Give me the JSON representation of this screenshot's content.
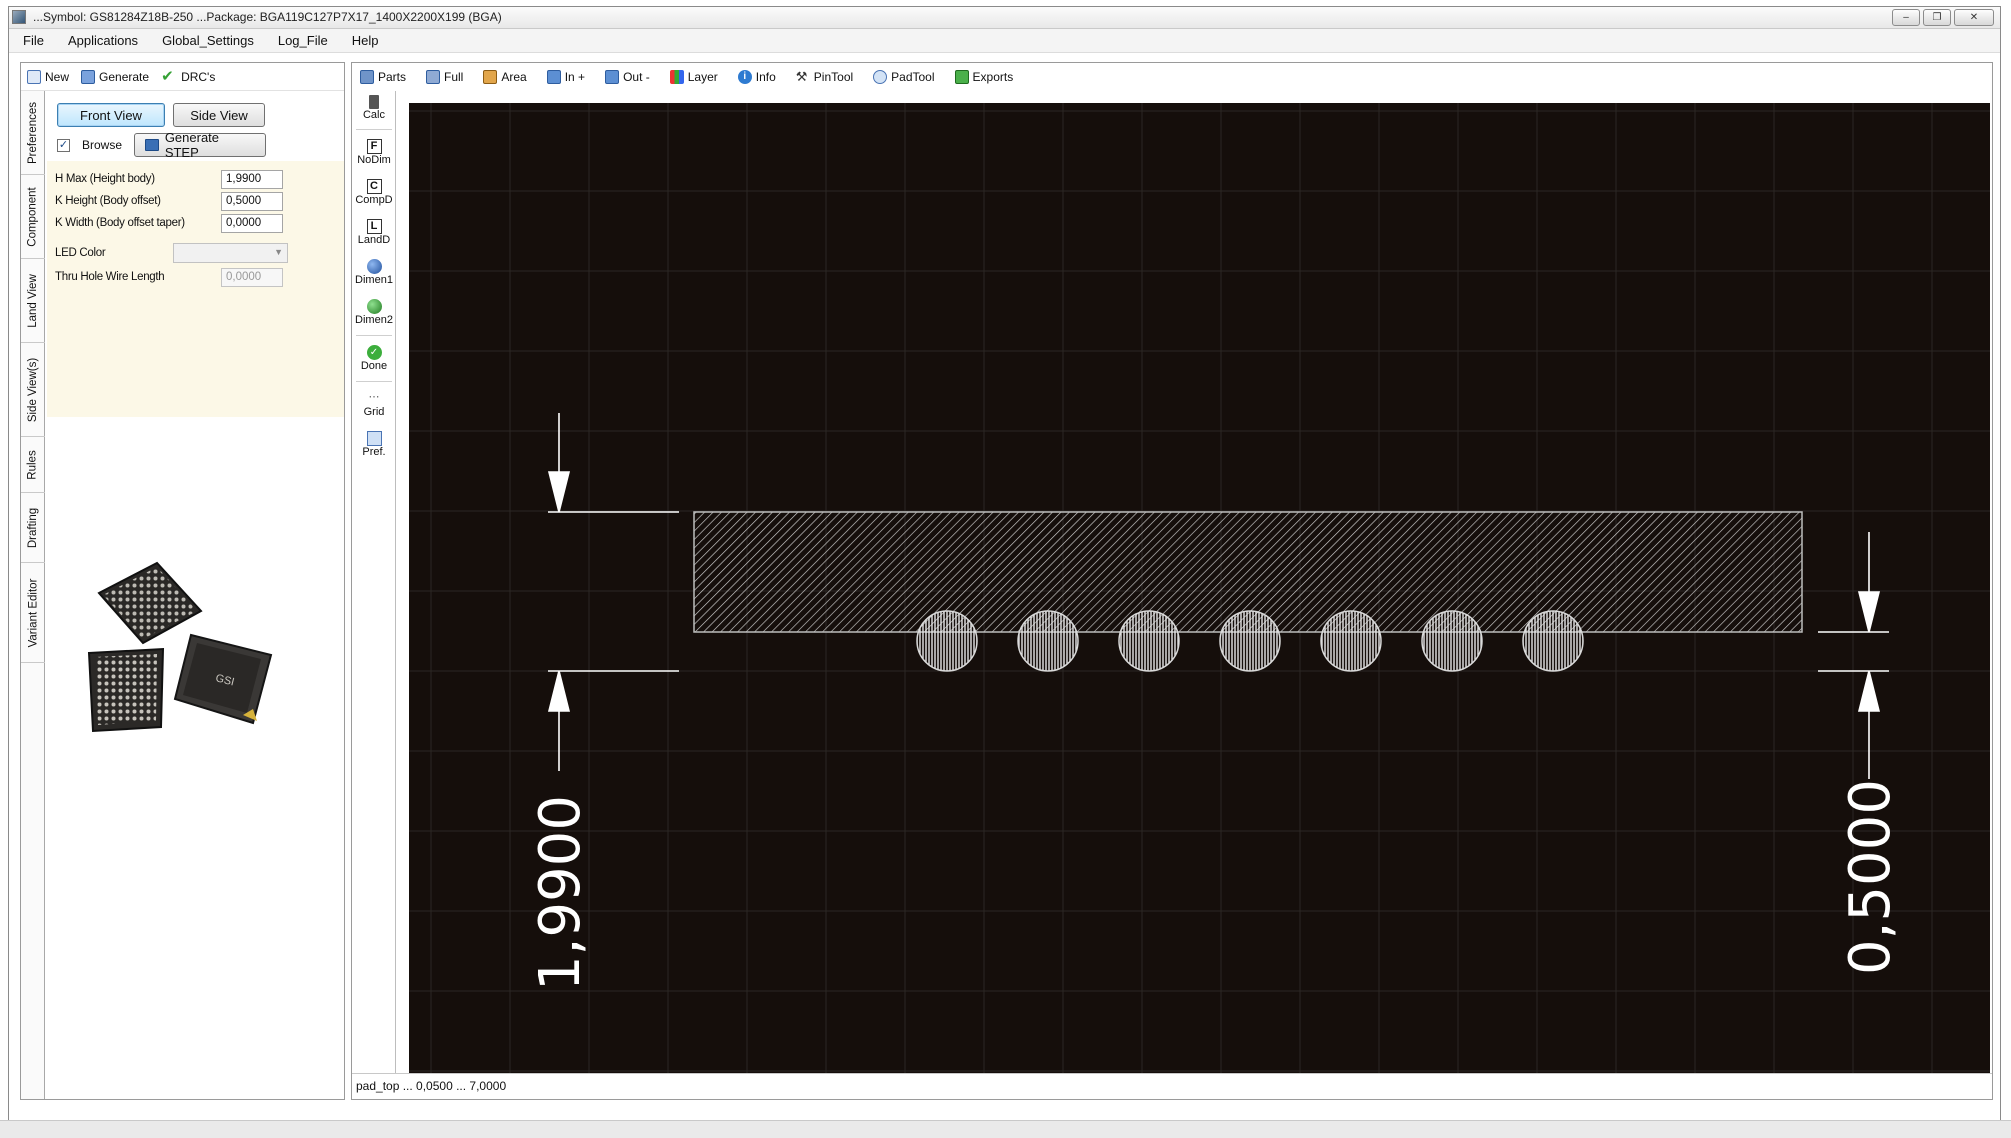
{
  "window": {
    "title": "...Symbol: GS81284Z18B-250 ...Package: BGA119C127P7X17_1400X2200X199  (BGA)",
    "controls": [
      "minimize",
      "maximize",
      "close"
    ]
  },
  "menu": {
    "items": [
      "File",
      "Applications",
      "Global_Settings",
      "Log_File",
      "Help"
    ]
  },
  "left_toolbar": {
    "new_label": "New",
    "generate_label": "Generate",
    "drc_label": "DRC's"
  },
  "vertical_tabs": [
    "Preferences",
    "Component",
    "Land View",
    "Side View(s)",
    "Rules",
    "Drafting",
    "Variant Editor"
  ],
  "view_buttons": {
    "front": "Front View",
    "side": "Side View",
    "browse": "Browse",
    "browse_checked": true,
    "generate_step": "Generate STEP"
  },
  "fields": {
    "h_max": {
      "label": "H Max (Height body)",
      "value": "1,9900"
    },
    "k_height": {
      "label": "K Height (Body offset)",
      "value": "0,5000"
    },
    "k_width": {
      "label": "K Width (Body offset taper)",
      "value": "0,0000"
    },
    "led_color": {
      "label": "LED Color",
      "value": ""
    },
    "thru_hole": {
      "label": "Thru Hole Wire Length",
      "value": "0,0000"
    }
  },
  "chip_image": {
    "logo_text": "GSI"
  },
  "main_toolbar": {
    "items": [
      {
        "label": "Parts",
        "icon": "parts-icon"
      },
      {
        "label": "Full",
        "icon": "full-view-icon"
      },
      {
        "label": "Area",
        "icon": "area-zoom-icon"
      },
      {
        "label": "In +",
        "icon": "zoom-in-icon"
      },
      {
        "label": "Out -",
        "icon": "zoom-out-icon"
      },
      {
        "label": "Layer",
        "icon": "layer-icon"
      },
      {
        "label": "Info",
        "icon": "info-icon"
      },
      {
        "label": "PinTool",
        "icon": "pin-tool-icon"
      },
      {
        "label": "PadTool",
        "icon": "pad-tool-icon"
      },
      {
        "label": "Exports",
        "icon": "exports-icon"
      }
    ]
  },
  "side_tools": {
    "calc": "Calc",
    "nodim": "NoDim",
    "compd": "CompD",
    "landd": "LandD",
    "dimen1": "Dimen1",
    "dimen2": "Dimen2",
    "done": "Done",
    "grid": "Grid",
    "pref": "Pref.",
    "glyph_f": "F",
    "glyph_c": "C",
    "glyph_l": "L"
  },
  "drawing": {
    "height_dim": "1,9900",
    "offset_dim": "0,5000",
    "ball_count": 7,
    "background": "#150e0b",
    "grid_color": "#2c2724",
    "line_color": "#ffffff"
  },
  "status": {
    "text": "pad_top ... 0,0500 ... 7,0000"
  }
}
